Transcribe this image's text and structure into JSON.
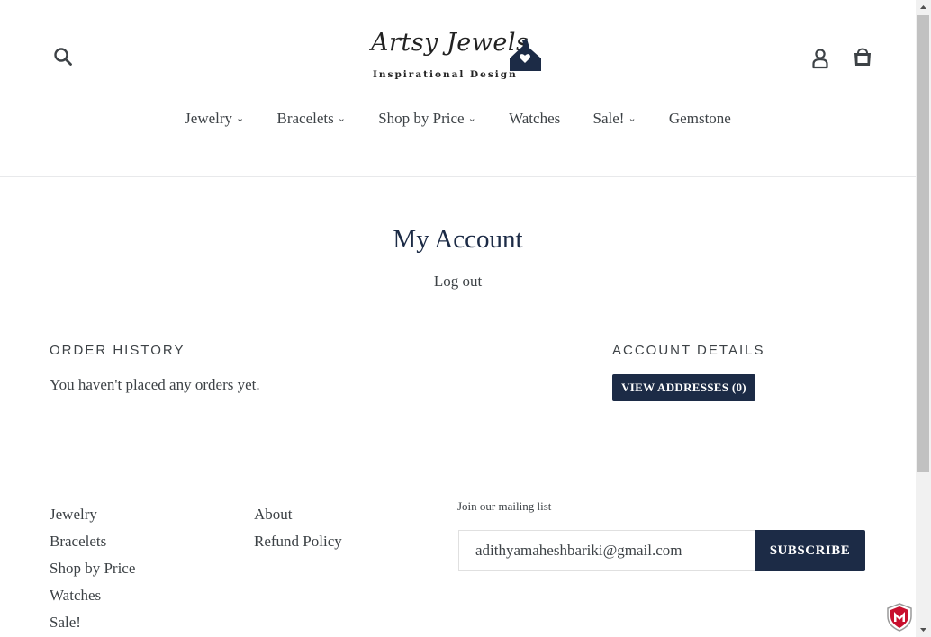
{
  "header": {
    "logo_script": "Artsy Jewels",
    "logo_tagline": "Inspirational Design",
    "icons": [
      "search-icon",
      "user-icon",
      "cart-icon"
    ]
  },
  "nav": {
    "items": [
      {
        "label": "Jewelry",
        "dropdown": true
      },
      {
        "label": "Bracelets",
        "dropdown": true
      },
      {
        "label": "Shop by Price",
        "dropdown": true
      },
      {
        "label": "Watches",
        "dropdown": false
      },
      {
        "label": "Sale!",
        "dropdown": true
      },
      {
        "label": "Gemstone",
        "dropdown": false
      }
    ]
  },
  "main": {
    "title": "My Account",
    "logout": "Log out",
    "order_history": {
      "heading": "ORDER HISTORY",
      "empty_text": "You haven't placed any orders yet."
    },
    "account_details": {
      "heading": "ACCOUNT DETAILS",
      "addresses_button": "VIEW ADDRESSES (0)"
    }
  },
  "footer": {
    "col1": [
      "Jewelry",
      "Bracelets",
      "Shop by Price",
      "Watches",
      "Sale!"
    ],
    "col2": [
      "About",
      "Refund Policy"
    ],
    "mailing_label": "Join our mailing list",
    "email_value": "adithyamaheshbariki@gmail.com",
    "subscribe_label": "SUBSCRIBE"
  },
  "colors": {
    "accent": "#1c2b46",
    "text": "#3d4246",
    "rule": "#e8e9eb"
  }
}
